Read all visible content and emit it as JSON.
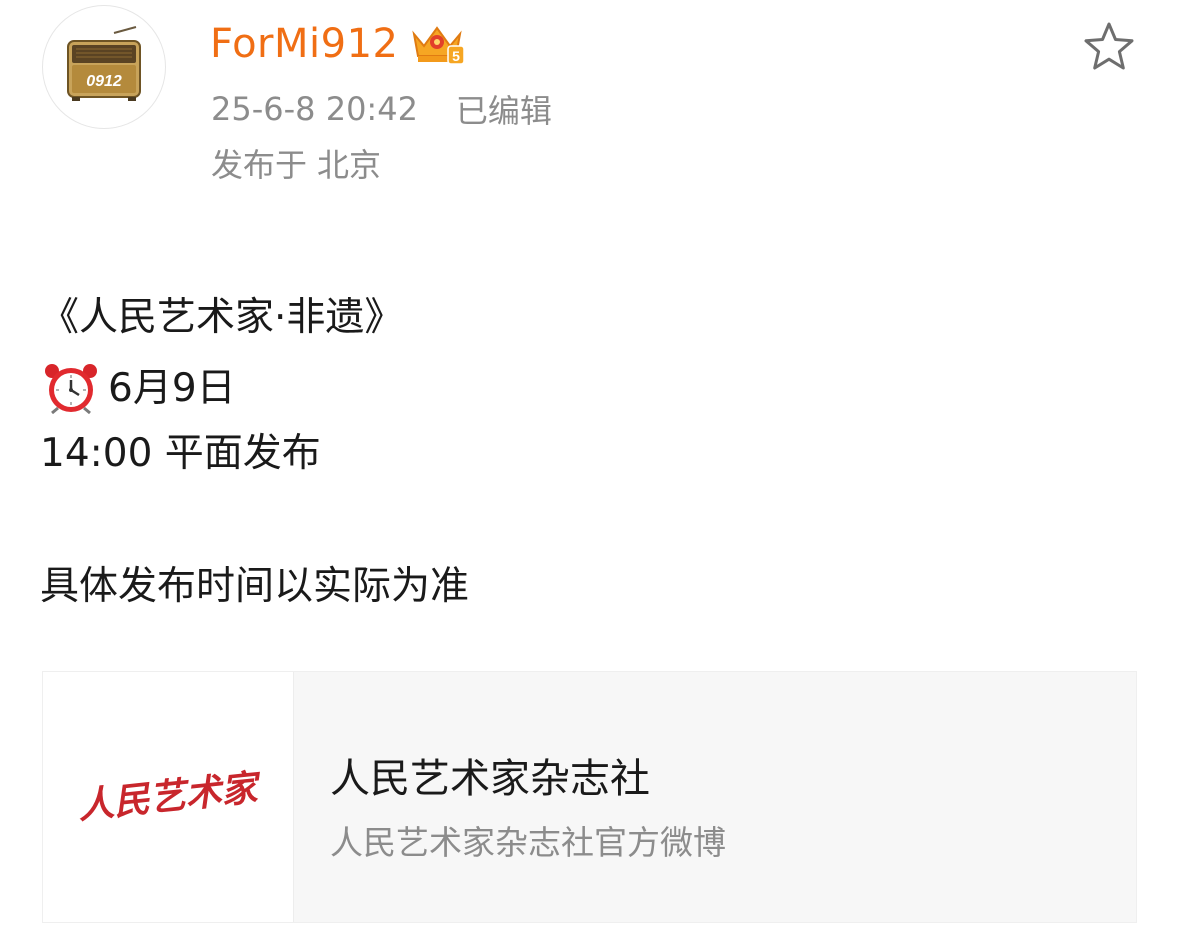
{
  "post": {
    "author": {
      "name": "ForMi912",
      "avatar_text": "0912",
      "badge_icon": "vip-crown-badge-icon",
      "badge_level": "5",
      "name_color": "#f06e14"
    },
    "timestamp": "25-6-8 20:42",
    "edited_label": "已编辑",
    "location_prefix": "发布于",
    "location": "北京",
    "favorite_icon": "star-outline-icon",
    "content": {
      "line1": "《人民艺术家·非遗》",
      "line2_icon": "alarm-clock-icon",
      "line2_text": "6月9日",
      "line3": "14:00 平面发布",
      "line4": "具体发布时间以实际为准"
    }
  },
  "link_card": {
    "logo_text": "人民艺术家",
    "logo_color": "#c8262c",
    "title": "人民艺术家杂志社",
    "subtitle": "人民艺术家杂志社官方微博"
  }
}
